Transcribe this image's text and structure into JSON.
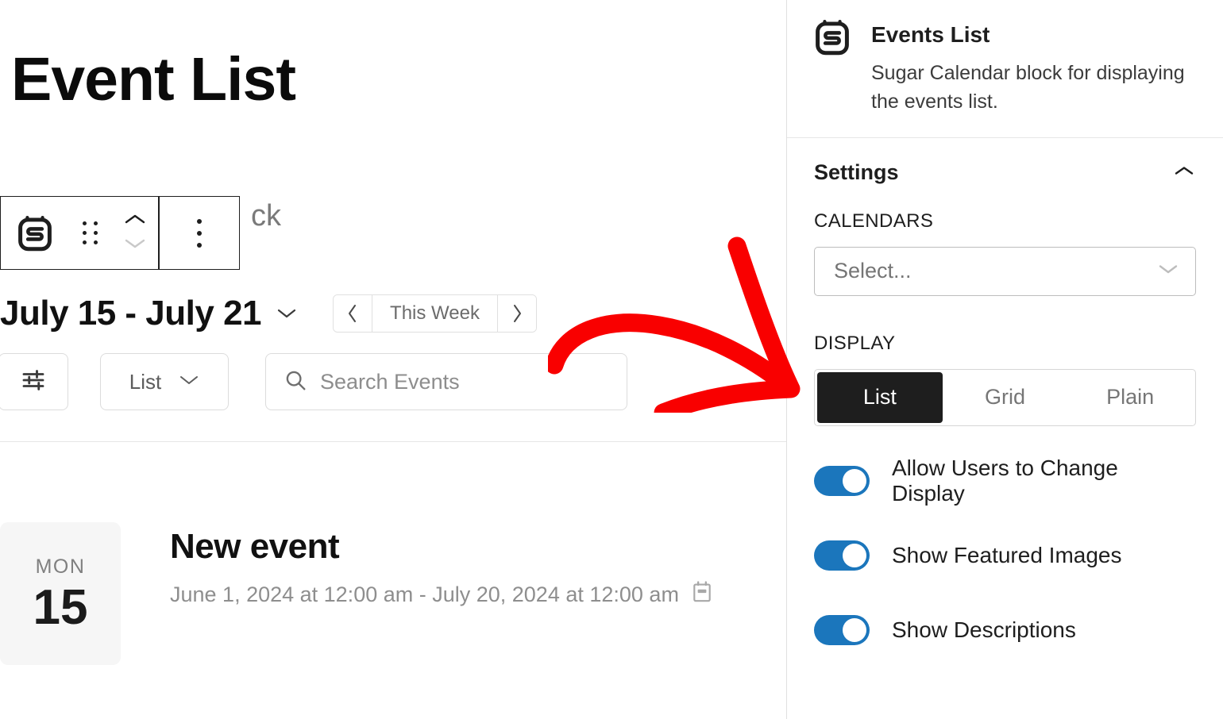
{
  "canvas": {
    "page_title": "Event List",
    "ghost_text": "ck",
    "block_toolbar": {
      "block_icon": "sugar-calendar-icon",
      "drag_handle": "drag-handle-icon",
      "move_up": "chevron-up-icon",
      "move_down": "chevron-down-icon",
      "more_options": "more-vertical-icon"
    },
    "week": {
      "range_label": "July 15 - July 21",
      "range_caret": "chevron-down-icon",
      "prev_label": "‹",
      "this_week_label": "This Week",
      "next_label": "›"
    },
    "controls": {
      "filter_icon": "sliders-icon",
      "view_label": "List",
      "view_caret": "chevron-down-icon",
      "search_icon": "search-icon",
      "search_placeholder": "Search Events",
      "search_value": ""
    },
    "event": {
      "day_of_week": "MON",
      "day_number": "15",
      "title": "New event",
      "datetime": "June 1, 2024 at 12:00 am - July 20, 2024 at 12:00 am",
      "meta_icon": "calendar-icon"
    }
  },
  "sidebar": {
    "block_icon": "sugar-calendar-icon",
    "block_title": "Events List",
    "block_description": "Sugar Calendar block for displaying the events list.",
    "settings": {
      "heading": "Settings",
      "collapse_icon": "chevron-up-icon",
      "calendars": {
        "label": "CALENDARS",
        "select_placeholder": "Select...",
        "select_value": "",
        "caret_icon": "chevron-down-icon"
      },
      "display": {
        "label": "DISPLAY",
        "options": [
          "List",
          "Grid",
          "Plain"
        ],
        "selected": "List"
      },
      "toggles": [
        {
          "label": "Allow Users to Change Display",
          "on": true
        },
        {
          "label": "Show Featured Images",
          "on": true
        },
        {
          "label": "Show Descriptions",
          "on": true
        }
      ]
    }
  },
  "annotation": {
    "type": "curved-arrow",
    "color": "#f90000",
    "points_to": "DISPLAY"
  },
  "colors": {
    "accent_toggle": "#1b76bc",
    "active_segment_bg": "#1e1e1e",
    "annotation_red": "#f90000",
    "border_gray": "#e0e0e0",
    "badge_bg": "#f6f6f6"
  }
}
